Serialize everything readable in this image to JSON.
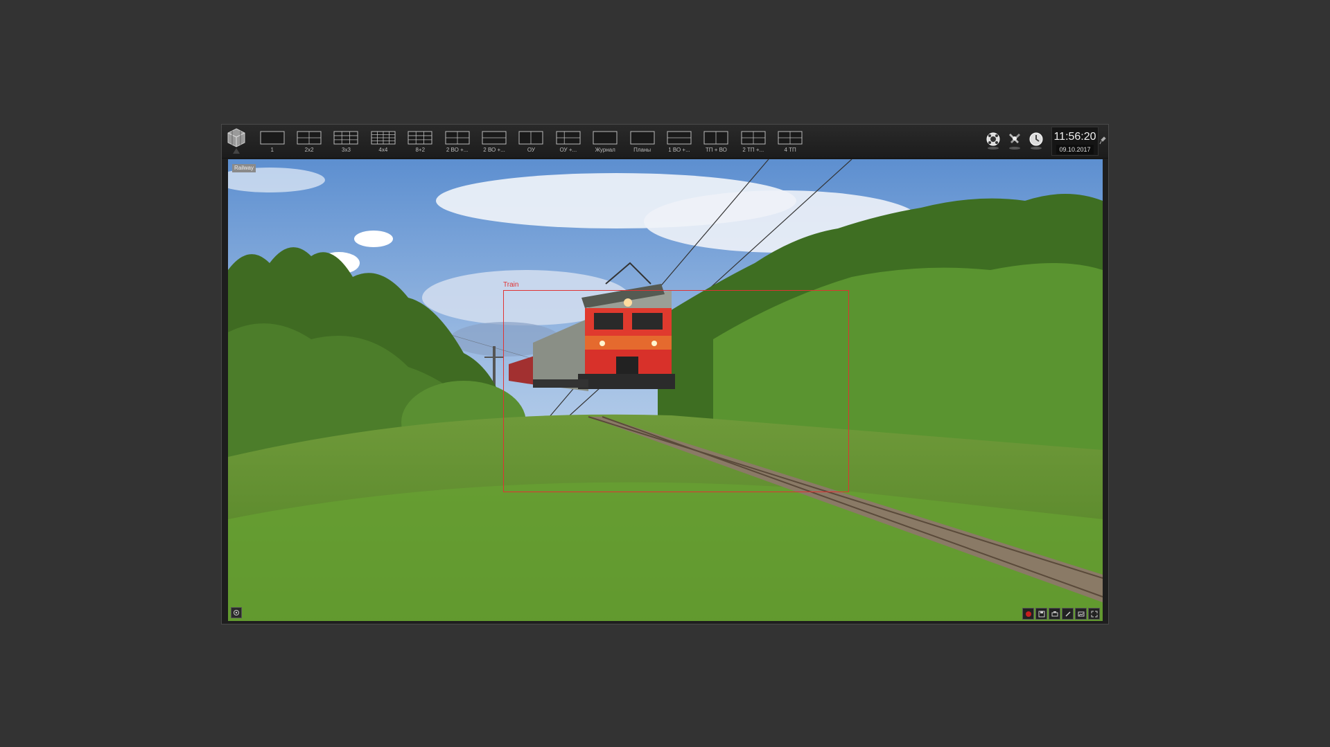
{
  "toolbar": {
    "layouts": [
      {
        "label": "1",
        "icon": "layout-1-icon"
      },
      {
        "label": "2x2",
        "icon": "layout-2x2-icon"
      },
      {
        "label": "3x3",
        "icon": "layout-3x3-icon"
      },
      {
        "label": "4x4",
        "icon": "layout-4x4-icon"
      },
      {
        "label": "8+2",
        "icon": "layout-8plus2-icon"
      },
      {
        "label": "2 ВО +...",
        "icon": "layout-2vo-icon"
      },
      {
        "label": "2 ВО +...",
        "icon": "layout-2vo-b-icon"
      },
      {
        "label": "ОУ",
        "icon": "layout-ou-icon"
      },
      {
        "label": "ОУ +...",
        "icon": "layout-ou-plus-icon"
      },
      {
        "label": "Журнал",
        "icon": "journal-icon"
      },
      {
        "label": "Планы",
        "icon": "plans-icon"
      },
      {
        "label": "1 ВО +...",
        "icon": "layout-1vo-icon"
      },
      {
        "label": "ТП + ВО",
        "icon": "layout-tp-vo-icon"
      },
      {
        "label": "2 ТП +...",
        "icon": "layout-2tp-icon"
      },
      {
        "label": "4 ТП",
        "icon": "layout-4tp-icon"
      }
    ]
  },
  "tray": {
    "time": "11:56:20",
    "date": "09.10.2017",
    "icons": [
      "network-status-icon",
      "tools-icon",
      "alarm-icon"
    ]
  },
  "view": {
    "camera_name": "Railway",
    "detection_label": "Train",
    "detection_color": "#e03232"
  },
  "controls": [
    "record-icon",
    "save-icon",
    "print-icon",
    "edit-icon",
    "snapshot-icon",
    "fullscreen-icon"
  ]
}
